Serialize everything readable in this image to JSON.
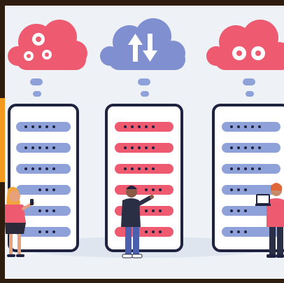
{
  "illustration": {
    "clouds": [
      {
        "icon": "gears-icon",
        "color": "#ee5a6f"
      },
      {
        "icon": "upload-download-arrows-icon",
        "color": "#7f8fd0"
      },
      {
        "icon": "gears-icon",
        "color": "#ee5a6f"
      }
    ],
    "server_racks": [
      {
        "slot_color": "#8fa1d9",
        "slots": 6
      },
      {
        "slot_color": "#ee5a6f",
        "slots": 6
      },
      {
        "slot_color": "#8fa1d9",
        "slots": 6
      }
    ],
    "people": [
      {
        "role": "woman-with-phone"
      },
      {
        "role": "man-pointing"
      },
      {
        "role": "person-with-laptop"
      }
    ],
    "colors": {
      "background": "#eef2f7",
      "outline": "#1f2340",
      "red": "#ee5a6f",
      "blue": "#8fa1d9",
      "accent": "#f29a1f"
    }
  }
}
